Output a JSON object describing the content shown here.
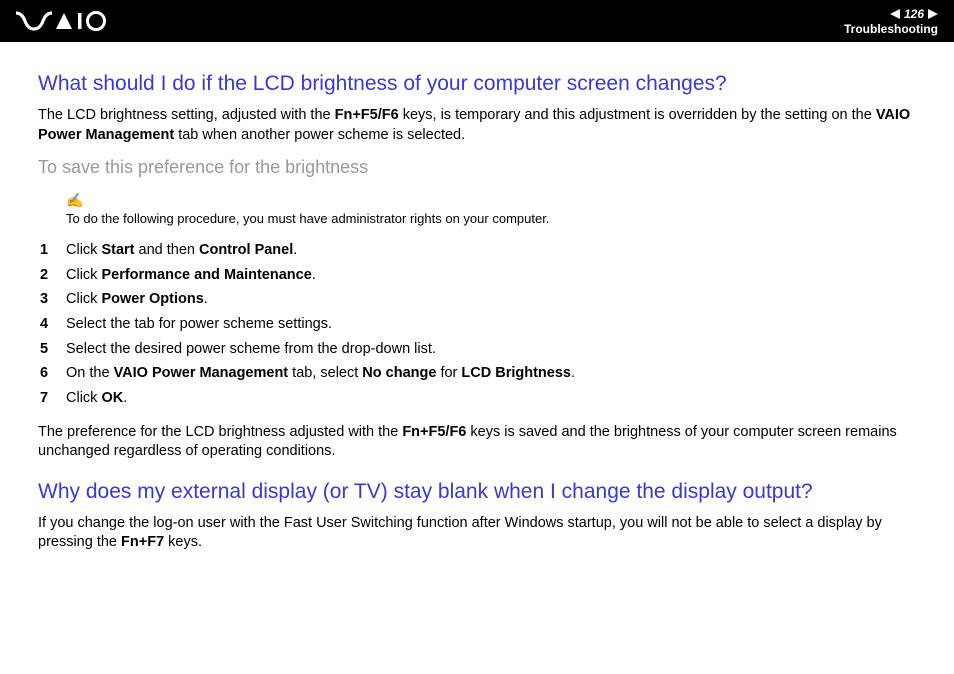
{
  "header": {
    "page_number": "126",
    "section": "Troubleshooting"
  },
  "section1": {
    "heading": "What should I do if the LCD brightness of your computer screen changes?",
    "intro_pre": "The LCD brightness setting, adjusted with the ",
    "intro_b1": "Fn+F5/F6",
    "intro_mid": " keys, is temporary and this adjustment is overridden by the setting on the ",
    "intro_b2": "VAIO Power Management",
    "intro_post": " tab when another power scheme is selected.",
    "subheading": "To save this preference for the brightness",
    "note": "To do the following procedure, you must have administrator rights on your computer.",
    "steps": [
      {
        "n": "1",
        "pre": "Click ",
        "b1": "Start",
        "mid": " and then ",
        "b2": "Control Panel",
        "post": "."
      },
      {
        "n": "2",
        "pre": "Click ",
        "b1": "Performance and Maintenance",
        "mid": "",
        "b2": "",
        "post": "."
      },
      {
        "n": "3",
        "pre": "Click ",
        "b1": "Power Options",
        "mid": "",
        "b2": "",
        "post": "."
      },
      {
        "n": "4",
        "pre": "Select the tab for power scheme settings.",
        "b1": "",
        "mid": "",
        "b2": "",
        "post": ""
      },
      {
        "n": "5",
        "pre": "Select the desired power scheme from the drop-down list.",
        "b1": "",
        "mid": "",
        "b2": "",
        "post": ""
      },
      {
        "n": "6",
        "pre": "On the ",
        "b1": "VAIO Power Management",
        "mid": " tab, select ",
        "b2": "No change",
        "mid2": " for ",
        "b3": "LCD Brightness",
        "post": "."
      },
      {
        "n": "7",
        "pre": "Click ",
        "b1": "OK",
        "mid": "",
        "b2": "",
        "post": "."
      }
    ],
    "outro_pre": "The preference for the LCD brightness adjusted with the ",
    "outro_b1": "Fn+F5/F6",
    "outro_post": " keys is saved and the brightness of your computer screen remains unchanged regardless of operating conditions."
  },
  "section2": {
    "heading": "Why does my external display (or TV) stay blank when I change the display output?",
    "body_pre": "If you change the log-on user with the Fast User Switching function after Windows startup, you will not be able to select a display by pressing the ",
    "body_b1": "Fn+F7",
    "body_post": " keys."
  }
}
